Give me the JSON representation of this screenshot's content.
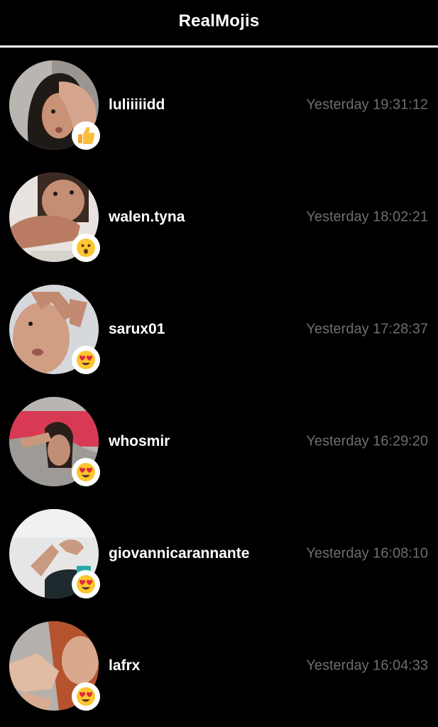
{
  "header": {
    "title": "RealMojis"
  },
  "items": [
    {
      "username": "luliiiiidd",
      "time": "Yesterday 19:31:12",
      "reaction": "thumbs-up"
    },
    {
      "username": "walen.tyna",
      "time": "Yesterday 18:02:21",
      "reaction": "surprised"
    },
    {
      "username": "sarux01",
      "time": "Yesterday 17:28:37",
      "reaction": "heart-eyes"
    },
    {
      "username": "whosmir",
      "time": "Yesterday 16:29:20",
      "reaction": "heart-eyes"
    },
    {
      "username": "giovannicarannante",
      "time": "Yesterday 16:08:10",
      "reaction": "heart-eyes"
    },
    {
      "username": "lafrx",
      "time": "Yesterday 16:04:33",
      "reaction": "heart-eyes"
    }
  ]
}
